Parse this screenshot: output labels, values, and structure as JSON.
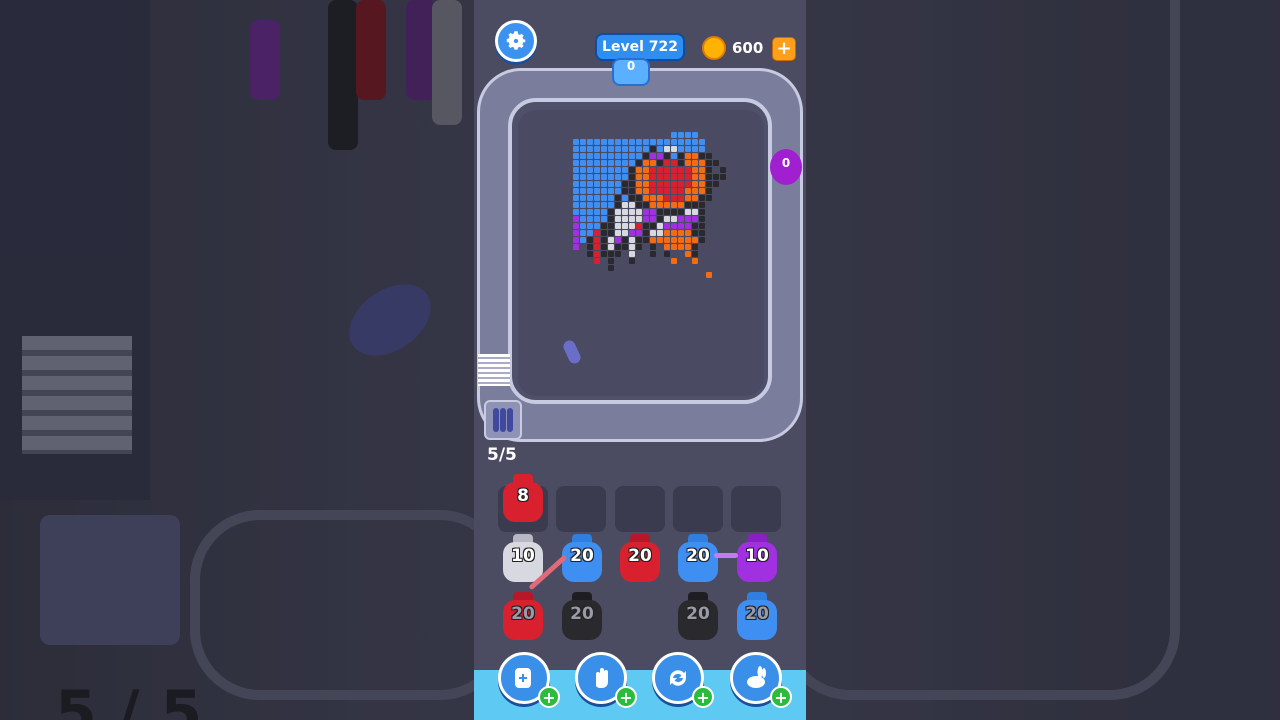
{
  "header": {
    "level_label": "Level 722",
    "coins": "600",
    "coin_add": "+"
  },
  "board": {
    "capacity": "5/5",
    "conveyor_counter": "0",
    "purple_counter": "0"
  },
  "slots": {
    "queue_count": "8",
    "empty_slots": 4
  },
  "jars": [
    {
      "count": "10",
      "color": "#d8d8e0"
    },
    {
      "count": "20",
      "color": "#3f8ff2"
    },
    {
      "count": "20",
      "color": "#d8202e"
    },
    {
      "count": "20",
      "color": "#3f8ff2"
    },
    {
      "count": "10",
      "color": "#a030e0"
    },
    {
      "count": "20",
      "color": "#d8202e"
    },
    {
      "count": "20",
      "color": "#2a2a2e"
    },
    {
      "count": "20",
      "color": "#2a2a2e"
    },
    {
      "count": "20",
      "color": "#3f8ff2"
    }
  ],
  "tools": {
    "plus_label": "+"
  },
  "icons": {
    "settings": "gear-icon",
    "coin": "coin-icon",
    "tool1": "add-slot-icon",
    "tool2": "hand-icon",
    "tool3": "shuffle-icon",
    "tool4": "rabbit-icon"
  },
  "colors": {
    "red": "#d8202e",
    "blue": "#3f8ff2",
    "purple": "#a030e0",
    "black": "#2a2a2e",
    "white": "#d8d8e0",
    "orange": "#f36b12"
  }
}
